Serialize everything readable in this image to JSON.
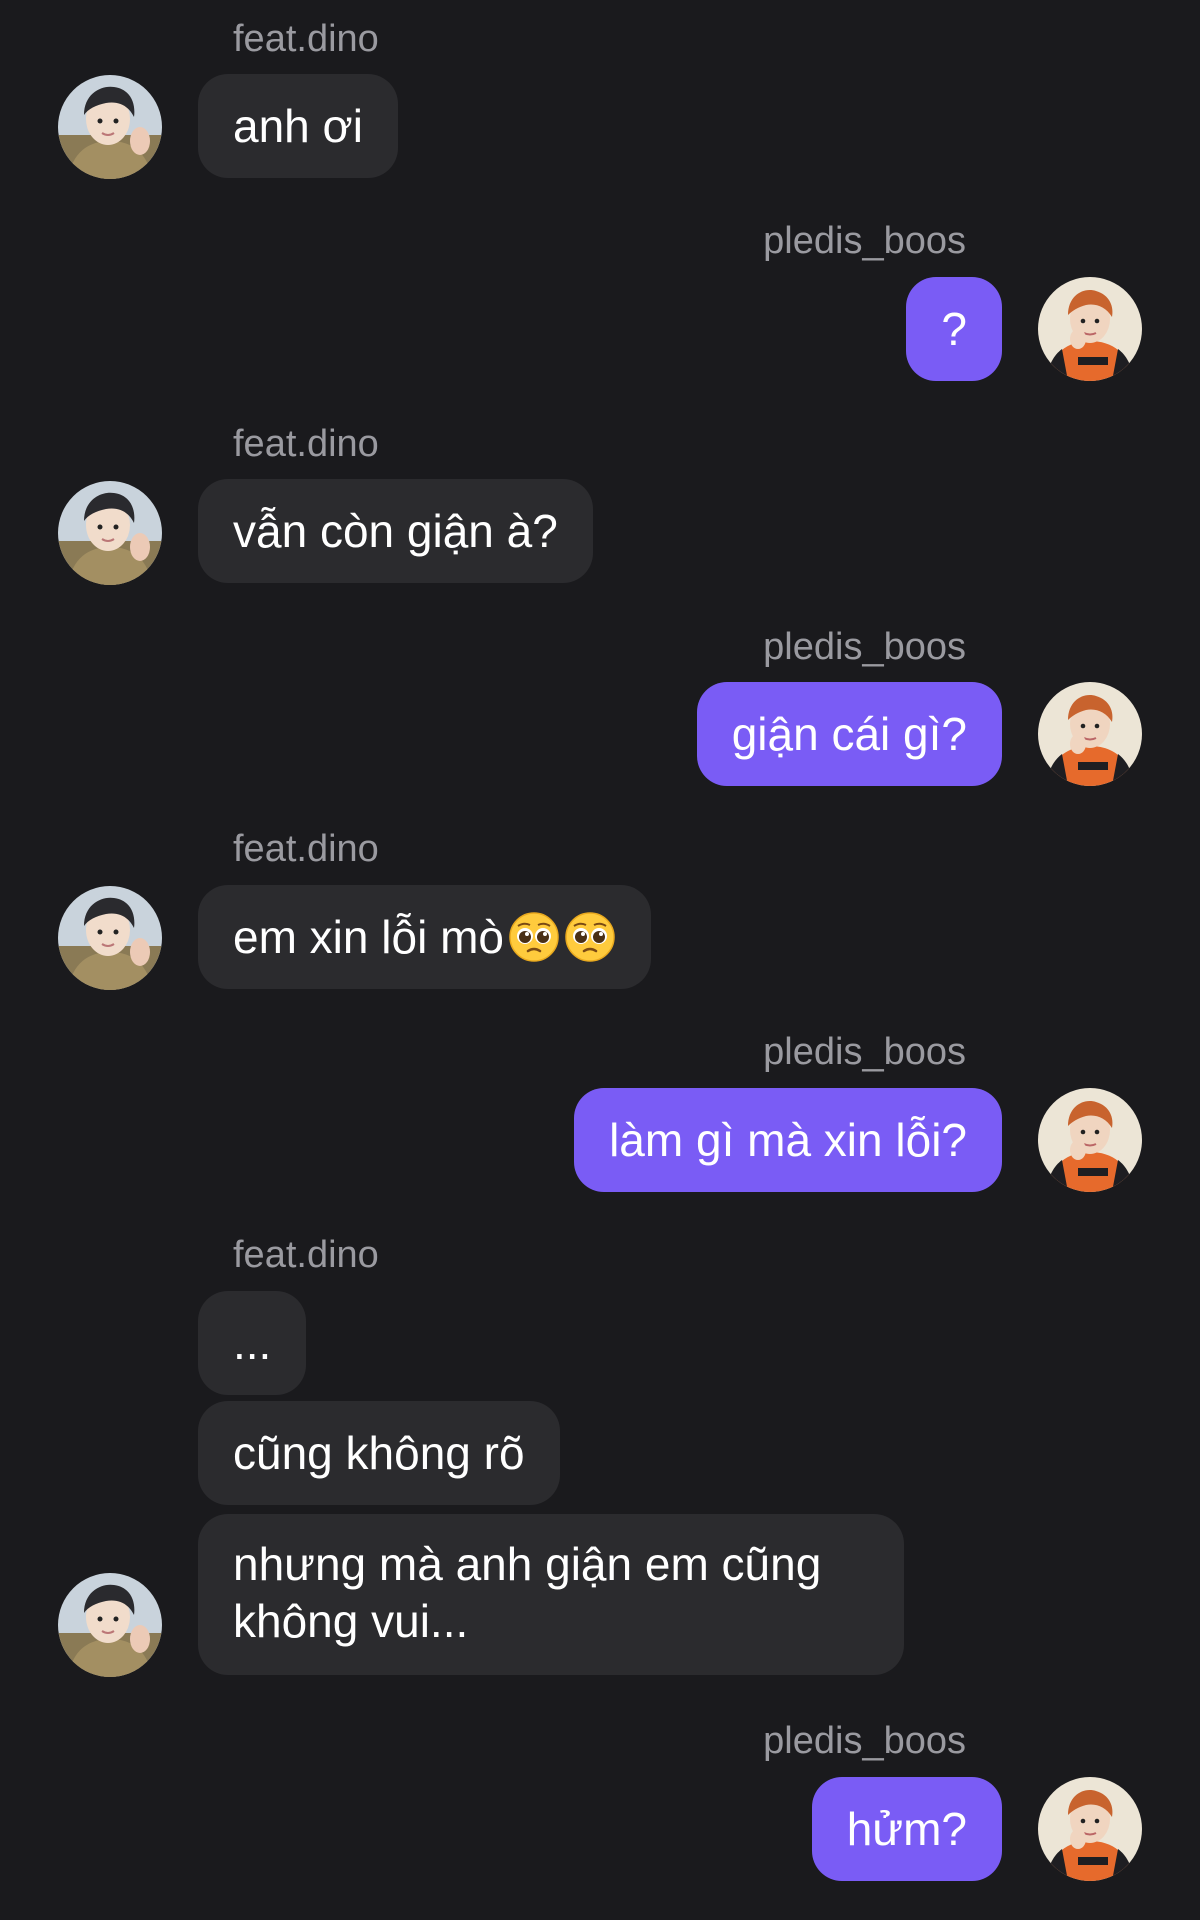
{
  "users": {
    "other": {
      "name": "feat.dino"
    },
    "me": {
      "name": "pledis_boos"
    }
  },
  "messages": [
    {
      "text": "anh ơi"
    },
    {
      "text": "?"
    },
    {
      "text": "vẫn còn giận à?"
    },
    {
      "text": "giận cái gì?"
    },
    {
      "text": "em xin lỗi mò",
      "emoji": [
        "pleading-face",
        "pleading-face"
      ]
    },
    {
      "text": "làm gì mà xin lỗi?"
    },
    {
      "text": "..."
    },
    {
      "text": "cũng không rõ"
    },
    {
      "text": "nhưng mà anh giận em cũng không vui..."
    },
    {
      "text": "hửm?"
    }
  ],
  "colors": {
    "background": "#1a1a1d",
    "incoming_bubble": "#2b2b2e",
    "outgoing_bubble": "#7a5cf5",
    "username": "#9a9aa0"
  }
}
